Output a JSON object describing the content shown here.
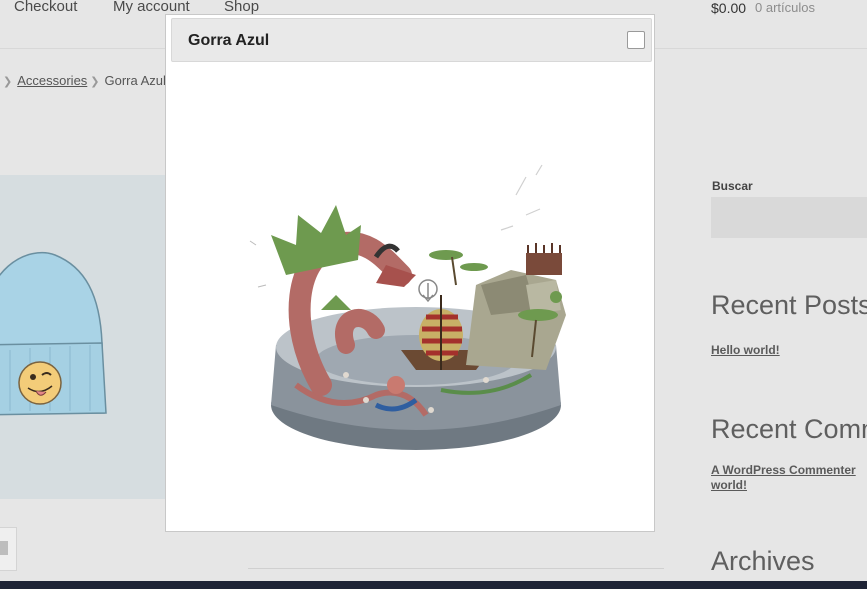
{
  "nav": {
    "checkout": "Checkout",
    "my_account": "My account",
    "shop": "Shop"
  },
  "cart": {
    "amount": "$0.00",
    "count": "0 artículos"
  },
  "breadcrumb": {
    "category": "Accessories",
    "current": "Gorra Azul"
  },
  "sidebar": {
    "search_label": "Buscar",
    "recent_posts_title": "Recent Posts",
    "recent_post_1": "Hello world!",
    "recent_comments_title": "Recent Comm",
    "comment_author": "A WordPress Commenter",
    "comment_post_suffix": "world!",
    "archives_title": "Archives"
  },
  "modal": {
    "title": "Gorra Azul",
    "viewer_icon": "3d-viewer-rotate-icon",
    "close_icon": "close-checkbox-icon"
  },
  "colors": {
    "hat_blue": "#a9d3e6",
    "dragon_red": "#b36b66",
    "foliage_green": "#6e9a4f",
    "base_gray": "#7f8891"
  }
}
